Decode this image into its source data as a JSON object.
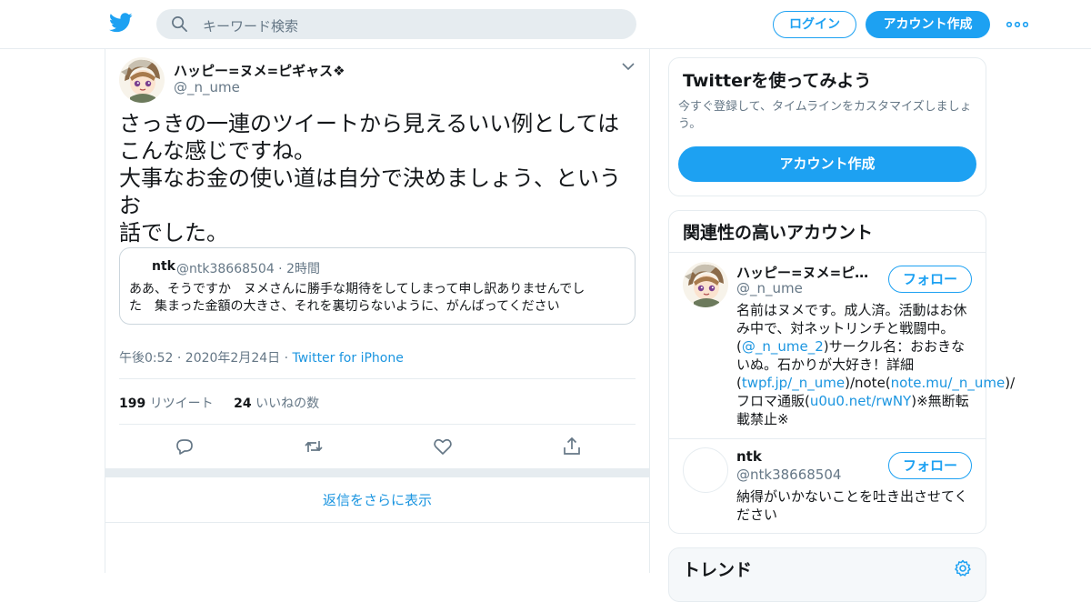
{
  "nav": {
    "search_placeholder": "キーワード検索",
    "login": "ログイン",
    "signup": "アカウント作成",
    "icons": [
      "twitter-bird-icon",
      "search-icon",
      "more-icon"
    ]
  },
  "tweet": {
    "display_name": "ハッピー=ヌメ=ピギャス❖",
    "handle": "@_n_ume",
    "text": "さっきの一連のツイートから見えるいい例としては\nこんな感じですね。\n大事なお金の使い道は自分で決めましょう、というお\n話でした。",
    "quote": {
      "name": "ntk",
      "handle": "@ntk38668504",
      "sep": " · ",
      "time": "2時間",
      "text": "ああ、そうですか　ヌメさんに勝手な期待をしてしまって申し訳ありませんでし\nた　集まった金額の大きさ、それを裏切らないように、がんばってください"
    },
    "timestamp": "午後0:52 · 2020年2月24日",
    "sep": " · ",
    "source": "Twitter for iPhone",
    "retweet_count": "199",
    "retweet_label": "リツイート",
    "like_count": "24",
    "like_label": "いいねの数",
    "actions": [
      "reply-icon",
      "retweet-icon",
      "like-icon",
      "share-icon"
    ]
  },
  "more_replies": "返信をさらに表示",
  "sidebar": {
    "signup_card": {
      "title": "Twitterを使ってみよう",
      "subtitle": "今すぐ登録して、タイムラインをカスタマイズしましょう。",
      "button": "アカウント作成"
    },
    "related": {
      "title": "関連性の高いアカウント",
      "follow_label": "フォロー",
      "accounts": [
        {
          "name": "ハッピー=ヌメ=ピギャス❖",
          "handle": "@_n_ume",
          "bio_1": "名前はヌメです。成人済。活動はお休み中で、対ネットリンチと戦闘中。(",
          "link_1": "@_n_ume_2",
          "bio_2": ")サークル名：おおきないぬ。石かりが大好き！詳細(",
          "link_2": "twpf.jp/_n_ume",
          "bio_3": ")/note(",
          "link_3": "note.mu/_n_ume",
          "bio_4": ")/フロマ通販(",
          "link_4": "u0u0.net/rwNY",
          "bio_5": ")※無断転載禁止※"
        },
        {
          "name": "ntk",
          "handle": "@ntk38668504",
          "bio": "納得がいかないことを吐き出させてください"
        }
      ]
    },
    "trends": {
      "title": "トレンド",
      "icon": "gear-icon"
    }
  },
  "colors": {
    "accent": "#1da1f2",
    "link": "#1b95e0",
    "muted": "#657786",
    "border": "#e6ecf0"
  }
}
